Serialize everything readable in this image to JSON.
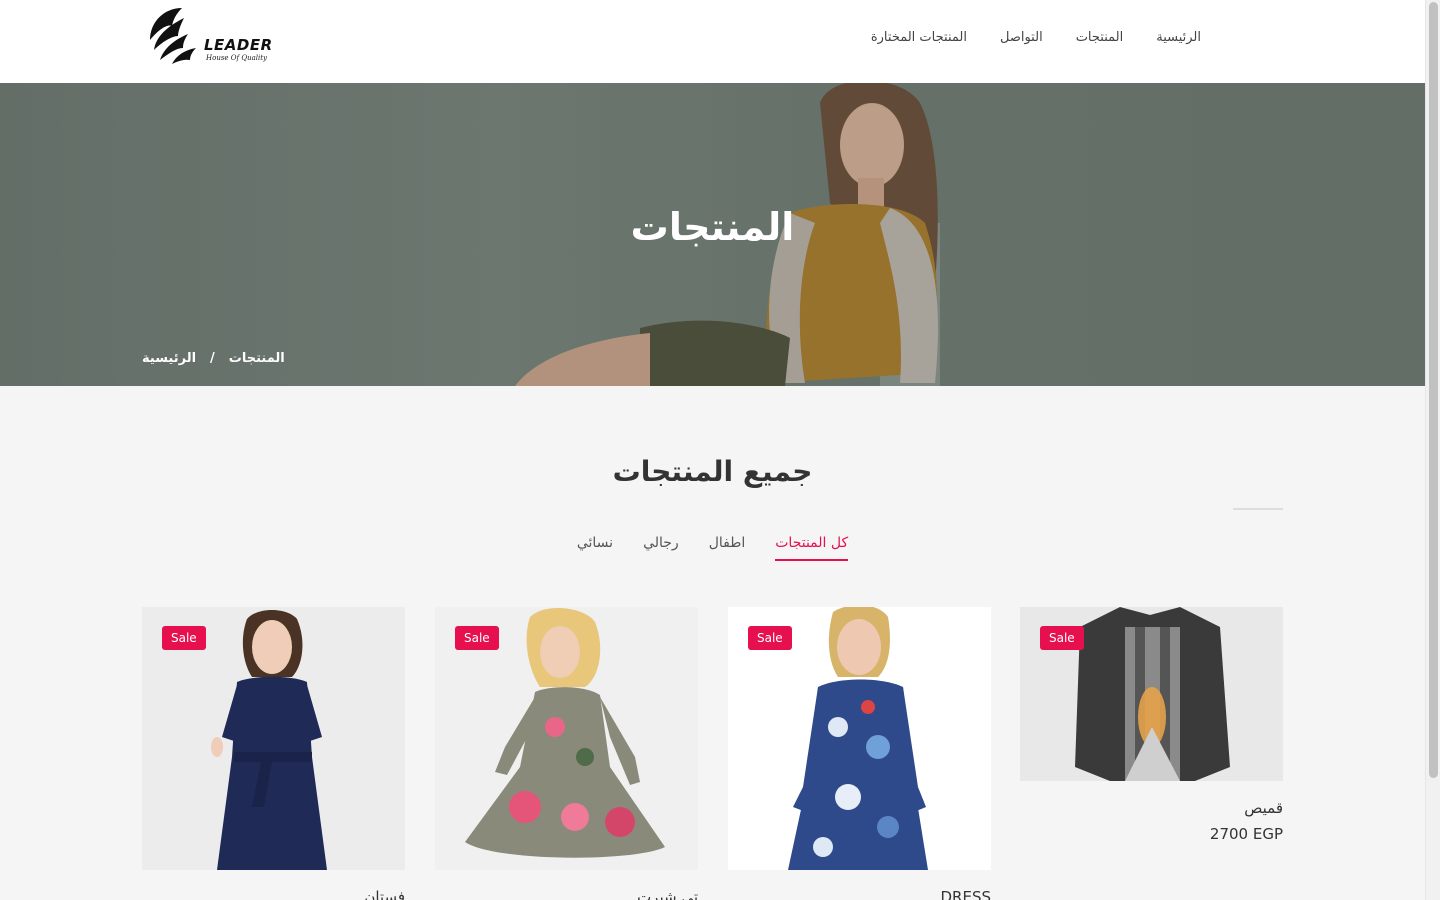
{
  "header": {
    "logo_text": "LEADER",
    "logo_tagline": "House Of Quality",
    "nav": [
      {
        "label": "الرئيسية"
      },
      {
        "label": "المنتجات"
      },
      {
        "label": "التواصل"
      },
      {
        "label": "المنتجات المختارة"
      }
    ]
  },
  "hero": {
    "title": "المنتجات",
    "breadcrumb": {
      "home": "الرئيسية",
      "separator": "/",
      "current": "المنتجات"
    }
  },
  "products_section": {
    "title": "جميع المنتجات",
    "filters": [
      {
        "label": "كل المنتجات",
        "active": true
      },
      {
        "label": "اطفال",
        "active": false
      },
      {
        "label": "رجالي",
        "active": false
      },
      {
        "label": "نسائي",
        "active": false
      }
    ],
    "items": [
      {
        "badge": "Sale",
        "name": "قميص",
        "price": "2700 EGP"
      },
      {
        "badge": "Sale",
        "name": "DRESS",
        "price": ""
      },
      {
        "badge": "Sale",
        "name": "تي شيرت",
        "price": ""
      },
      {
        "badge": "Sale",
        "name": "فستان",
        "price": ""
      }
    ]
  },
  "colors": {
    "accent": "#e6104f",
    "header_bg": "#ffffff",
    "page_bg": "#f5f5f5"
  }
}
